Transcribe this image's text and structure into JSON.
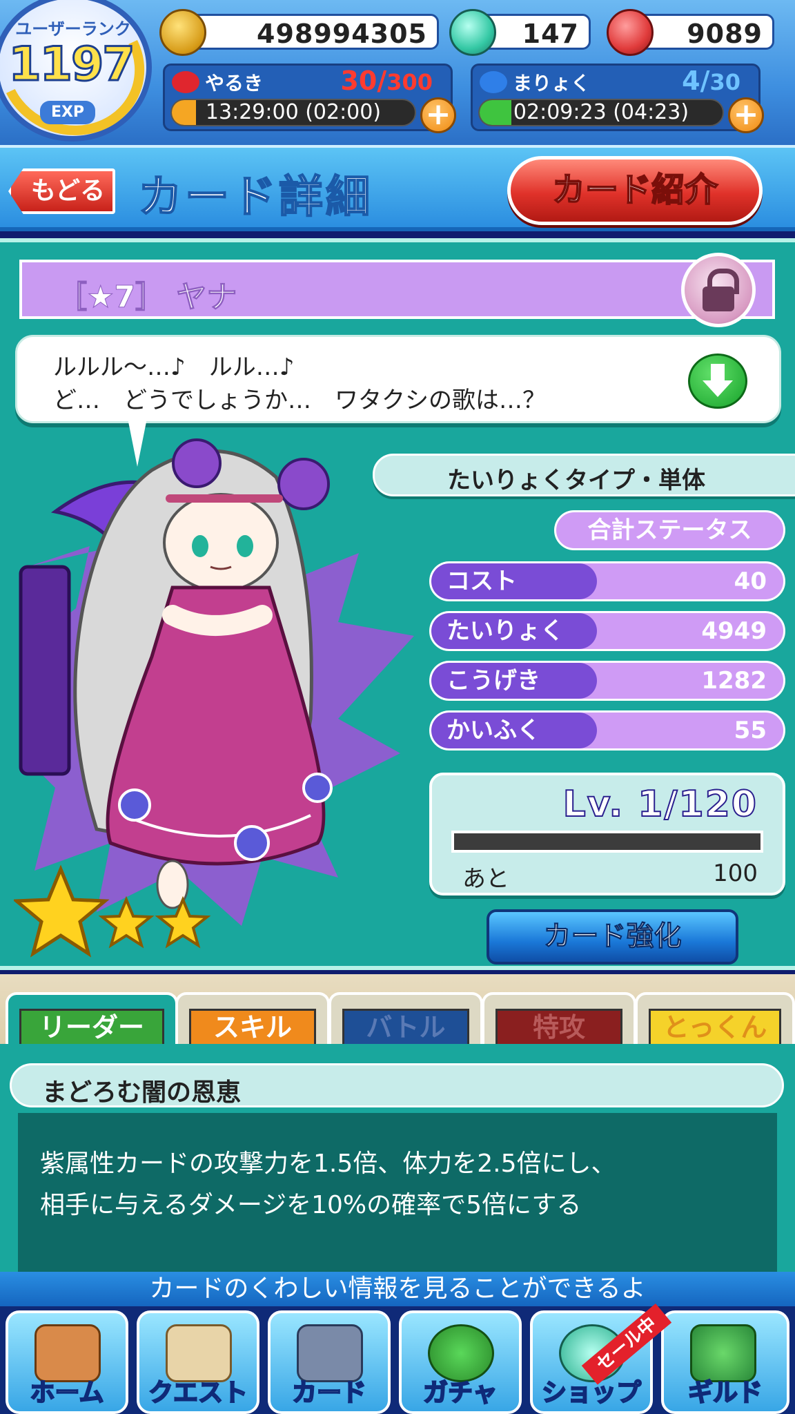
{
  "user_rank": {
    "label": "ユーザーランク",
    "value": "1197",
    "exp_label": "EXP"
  },
  "resources": [
    {
      "name": "coin",
      "icon": "coin-icon",
      "value": "498994305"
    },
    {
      "name": "gem",
      "icon": "gem-icon",
      "value": "147"
    },
    {
      "name": "meat",
      "icon": "meat-icon",
      "value": "9089"
    }
  ],
  "meters": [
    {
      "name": "yaruki",
      "label": "やるき",
      "current": "30",
      "max": "300",
      "value_color": "#ff3b2f",
      "time": "13:29:00 (02:00)",
      "fill_fraction": 0.1,
      "fill_color": "#f5a623"
    },
    {
      "name": "maryoku",
      "label": "まりょく",
      "current": "4",
      "max": "30",
      "value_color": "#6fc3ff",
      "time": "02:09:23 (04:23)",
      "fill_fraction": 0.13,
      "fill_color": "#3fc43f"
    }
  ],
  "header": {
    "back": "もどる",
    "title": "カード詳細",
    "intro": "カード紹介"
  },
  "card": {
    "name": "［★7］ ヤナ",
    "speech": [
      "ルルル～…♪　ルル…♪",
      "ど…　どうでしょうか…　ワタクシの歌は…？"
    ],
    "type": "たいりょくタイプ・単体",
    "total_label": "合計ステータス",
    "stats": [
      {
        "key": "コスト",
        "value": "40"
      },
      {
        "key": "たいりょく",
        "value": "4949"
      },
      {
        "key": "こうげき",
        "value": "1282"
      },
      {
        "key": "かいふく",
        "value": "55"
      }
    ],
    "level": "Lv. 1/120",
    "remaining_label": "あと",
    "remaining": "100",
    "enhance": "カード強化",
    "stars": 3
  },
  "tabs": [
    {
      "label": "リーダー",
      "color": "#39a53a",
      "active": true
    },
    {
      "label": "スキル",
      "color": "#f08a1c",
      "active": false
    },
    {
      "label": "バトル",
      "color": "#1e4f96",
      "active": false
    },
    {
      "label": "特攻",
      "color": "#8a1f1f",
      "active": false
    },
    {
      "label": "とっくん",
      "color": "#f5d22a",
      "active": false
    }
  ],
  "skill": {
    "name": "まどろむ闇の恩恵",
    "desc": [
      "紫属性カードの攻撃力を1.5倍、体力を2.5倍にし、",
      "相手に与えるダメージを10%の確率で5倍にする"
    ]
  },
  "hint": "カードのくわしい情報を見ることができるよ",
  "nav": [
    {
      "label": "ホーム",
      "icon": "house-icon"
    },
    {
      "label": "クエスト",
      "icon": "map-icon"
    },
    {
      "label": "カード",
      "icon": "card-icon"
    },
    {
      "label": "ガチャ",
      "icon": "puyo-icon"
    },
    {
      "label": "ショップ",
      "icon": "gem-shop-icon"
    },
    {
      "label": "ギルド",
      "icon": "guild-icon"
    }
  ],
  "sale_badge": "セール中"
}
